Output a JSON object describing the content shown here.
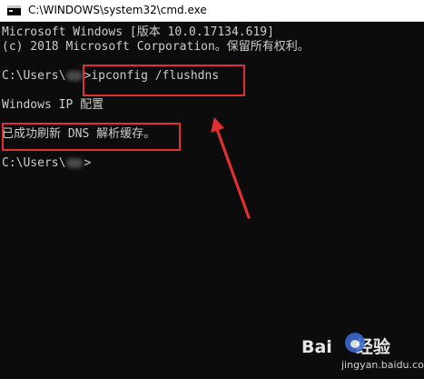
{
  "window": {
    "title": "C:\\WINDOWS\\system32\\cmd.exe",
    "icon": "cmd-console-icon"
  },
  "console": {
    "lines": [
      "Microsoft Windows [版本 10.0.17134.619]",
      "(c) 2018 Microsoft Corporation。保留所有权利。",
      "",
      "Windows IP 配置",
      "",
      "已成功刷新 DNS 解析缓存。"
    ],
    "prompt1_prefix": "C:\\Users\\",
    "prompt1_suffix": ">",
    "prompt1_command": "ipconfig /flushdns",
    "prompt2_prefix": "C:\\Users\\",
    "prompt2_suffix": ">"
  },
  "annotations": {
    "highlight_color": "#e03030"
  },
  "watermark": {
    "brand_left": "Bai",
    "brand_right": "经验",
    "url": "jingyan.baidu.com"
  },
  "colors": {
    "console_bg": "#0c0c0c",
    "console_text": "#cccccc",
    "titlebar_bg": "#ffffff"
  }
}
